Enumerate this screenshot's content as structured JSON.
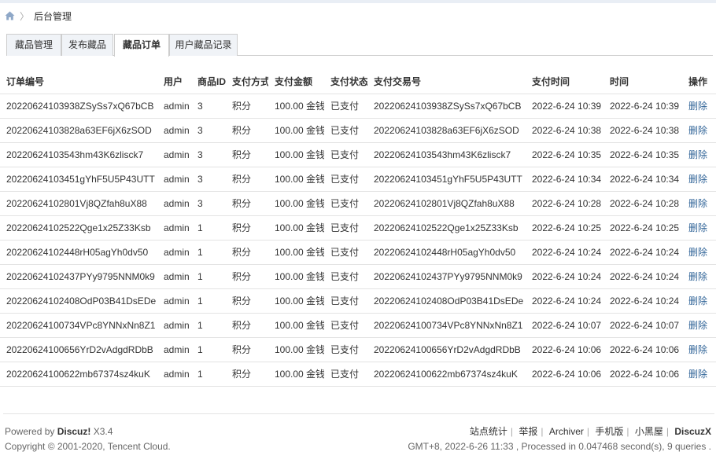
{
  "breadcrumb": {
    "current": "后台管理"
  },
  "tabs": [
    {
      "label": "藏品管理",
      "active": false
    },
    {
      "label": "发布藏品",
      "active": false
    },
    {
      "label": "藏品订单",
      "active": true
    },
    {
      "label": "用户藏品记录",
      "active": false
    }
  ],
  "table": {
    "headers": [
      "订单编号",
      "用户",
      "商品ID",
      "支付方式",
      "支付金额",
      "支付状态",
      "支付交易号",
      "支付时间",
      "时间",
      "操作"
    ],
    "rows": [
      [
        "20220624103938ZSySs7xQ67bCB",
        "admin",
        "3",
        "积分",
        "100.00 金钱",
        "已支付",
        "20220624103938ZSySs7xQ67bCB",
        "2022-6-24 10:39",
        "2022-6-24 10:39",
        "删除"
      ],
      [
        "20220624103828a63EF6jX6zSOD",
        "admin",
        "3",
        "积分",
        "100.00 金钱",
        "已支付",
        "20220624103828a63EF6jX6zSOD",
        "2022-6-24 10:38",
        "2022-6-24 10:38",
        "删除"
      ],
      [
        "20220624103543hm43K6zlisck7",
        "admin",
        "3",
        "积分",
        "100.00 金钱",
        "已支付",
        "20220624103543hm43K6zlisck7",
        "2022-6-24 10:35",
        "2022-6-24 10:35",
        "删除"
      ],
      [
        "20220624103451gYhF5U5P43UTT",
        "admin",
        "3",
        "积分",
        "100.00 金钱",
        "已支付",
        "20220624103451gYhF5U5P43UTT",
        "2022-6-24 10:34",
        "2022-6-24 10:34",
        "删除"
      ],
      [
        "20220624102801Vj8QZfah8uX88",
        "admin",
        "3",
        "积分",
        "100.00 金钱",
        "已支付",
        "20220624102801Vj8QZfah8uX88",
        "2022-6-24 10:28",
        "2022-6-24 10:28",
        "删除"
      ],
      [
        "20220624102522Qge1x25Z33Ksb",
        "admin",
        "1",
        "积分",
        "100.00 金钱",
        "已支付",
        "20220624102522Qge1x25Z33Ksb",
        "2022-6-24 10:25",
        "2022-6-24 10:25",
        "删除"
      ],
      [
        "20220624102448rH05agYh0dv50",
        "admin",
        "1",
        "积分",
        "100.00 金钱",
        "已支付",
        "20220624102448rH05agYh0dv50",
        "2022-6-24 10:24",
        "2022-6-24 10:24",
        "删除"
      ],
      [
        "20220624102437PYy9795NNM0k9",
        "admin",
        "1",
        "积分",
        "100.00 金钱",
        "已支付",
        "20220624102437PYy9795NNM0k9",
        "2022-6-24 10:24",
        "2022-6-24 10:24",
        "删除"
      ],
      [
        "20220624102408OdP03B41DsEDe",
        "admin",
        "1",
        "积分",
        "100.00 金钱",
        "已支付",
        "20220624102408OdP03B41DsEDe",
        "2022-6-24 10:24",
        "2022-6-24 10:24",
        "删除"
      ],
      [
        "20220624100734VPc8YNNxNn8Z1",
        "admin",
        "1",
        "积分",
        "100.00 金钱",
        "已支付",
        "20220624100734VPc8YNNxNn8Z1",
        "2022-6-24 10:07",
        "2022-6-24 10:07",
        "删除"
      ],
      [
        "20220624100656YrD2vAdgdRDbB",
        "admin",
        "1",
        "积分",
        "100.00 金钱",
        "已支付",
        "20220624100656YrD2vAdgdRDbB",
        "2022-6-24 10:06",
        "2022-6-24 10:06",
        "删除"
      ],
      [
        "20220624100622mb67374sz4kuK",
        "admin",
        "1",
        "积分",
        "100.00 金钱",
        "已支付",
        "20220624100622mb67374sz4kuK",
        "2022-6-24 10:06",
        "2022-6-24 10:06",
        "删除"
      ]
    ]
  },
  "footer": {
    "powered_prefix": "Powered by ",
    "powered_brand": "Discuz!",
    "powered_version": " X3.4",
    "copyright": "Copyright © 2001-2020, Tencent Cloud.",
    "links": [
      "站点统计",
      "举报",
      "Archiver",
      "手机版",
      "小黑屋"
    ],
    "brand": "DiscuzX",
    "stats": "GMT+8, 2022-6-26 11:33 , Processed in 0.047468 second(s), 9 queries ."
  },
  "colors": {
    "link": "#336699",
    "tab_bg": "#f0f3f7",
    "border": "#cdcdcd"
  }
}
